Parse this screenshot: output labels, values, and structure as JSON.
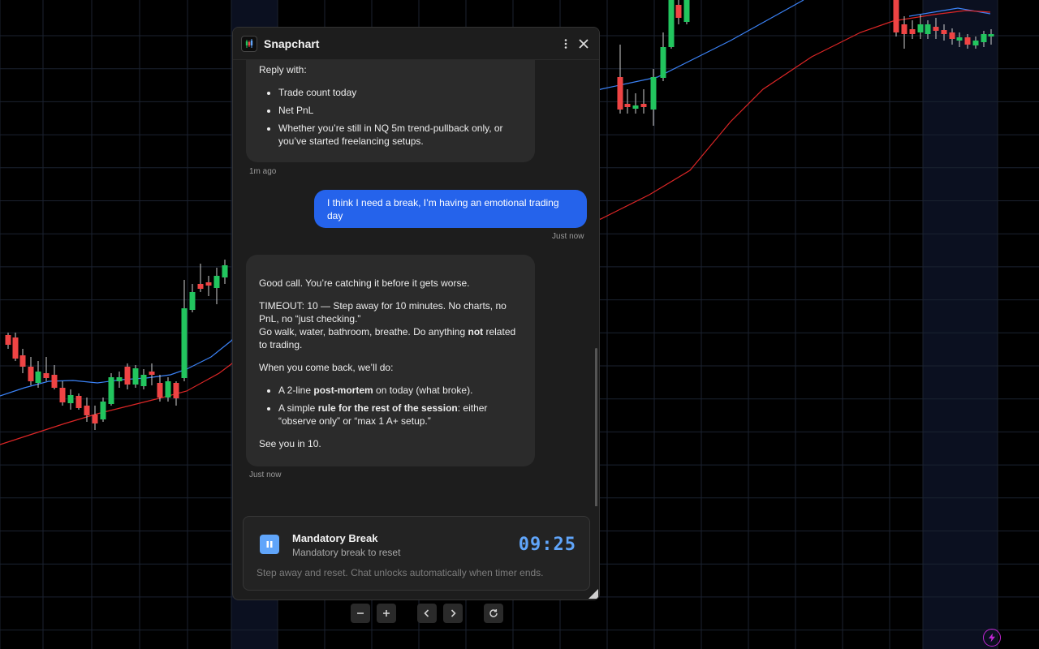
{
  "app": {
    "title": "Snapchart"
  },
  "chat": {
    "msg1": {
      "lead": "Reply with:",
      "items": [
        "Trade count today",
        "Net PnL",
        "Whether you’re still in NQ 5m trend-pullback only, or you’ve started freelancing setups."
      ],
      "time": "1m ago"
    },
    "msg2": {
      "text": "I think I need a break, I’m having an emotional trading day",
      "time": "Just now"
    },
    "msg3": {
      "p1": "Good call. You’re catching it before it gets worse.",
      "p2a": "TIMEOUT: 10 — Step away for 10 minutes. No charts, no PnL, no “just checking.”",
      "p2b_pre": "Go walk, water, bathroom, breathe. Do anything ",
      "p2b_bold": "not",
      "p2b_post": " related to trading.",
      "p3": "When you come back, we’ll do:",
      "b1_pre": "A 2-line ",
      "b1_bold": "post-mortem",
      "b1_post": " on today (what broke).",
      "b2_pre": "A simple ",
      "b2_bold": "rule for the rest of the session",
      "b2_post": ": either “observe only” or “max 1 A+ setup.”",
      "p4": "See you in 10.",
      "time": "Just now"
    }
  },
  "break": {
    "title": "Mandatory Break",
    "subtitle": "Mandatory break to reset",
    "timer": "09:25",
    "note": "Step away and reset. Chat unlocks automatically when timer ends.",
    "accent": "#60a5fa"
  },
  "colors": {
    "bull": "#22c55e",
    "bear": "#ef4444",
    "ma_fast": "#3b82f6",
    "ma_slow": "#dc2626",
    "user_bubble": "#2563eb"
  },
  "icons": {
    "menu": "more-vertical-icon",
    "close": "close-icon",
    "pause": "pause-icon",
    "bolt": "lightning-icon"
  }
}
